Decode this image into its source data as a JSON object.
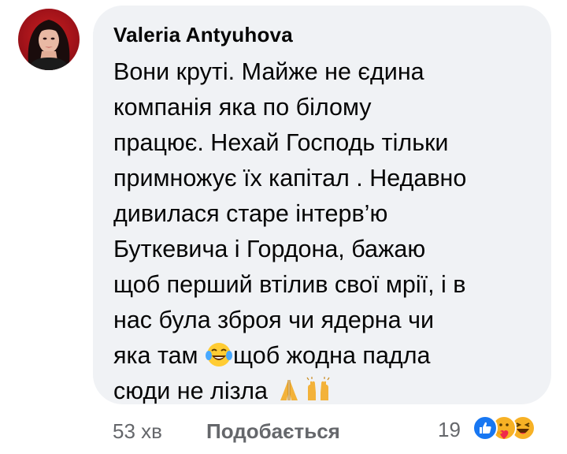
{
  "comment": {
    "author": "Valeria  Antyuhova",
    "lines": [
      "Вони круті. Майже не єдина",
      "компанія яка по білому",
      "працює. Нехай Господь тільки",
      "примножує їх капітал . Недавно",
      "дивилася старе  інтерв’ю",
      "Буткевича і Гордона, бажаю",
      "щоб перший втілив свої мрії, і в",
      "нас була зброя чи ядерна чи"
    ],
    "line9_before": "яка там ",
    "line9_after": "щоб жодна падла",
    "line10_text": "сюди не лізла ",
    "inline_emojis": [
      "tears-of-joy-emoji",
      "folded-hands-emoji",
      "raising-hands-emoji"
    ]
  },
  "footer": {
    "time": "53 хв",
    "like_label": "Подобається",
    "reaction_count": "19",
    "reaction_icons": [
      "like-icon",
      "care-icon",
      "haha-icon"
    ]
  },
  "colors": {
    "bubble_bg": "#f0f2f5",
    "text": "#050505",
    "secondary": "#65676b",
    "like_blue": "#1877f2"
  }
}
